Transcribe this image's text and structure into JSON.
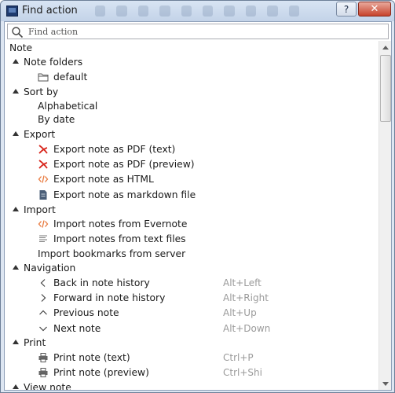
{
  "window": {
    "title": "Find action",
    "help_label": "?",
    "close_label": "✕"
  },
  "search": {
    "placeholder": "Find action"
  },
  "root_label": "Note",
  "groups": {
    "note_folders": {
      "label": "Note folders",
      "items": {
        "default": "default"
      }
    },
    "sort_by": {
      "label": "Sort by",
      "items": {
        "alphabetical": "Alphabetical",
        "by_date": "By date"
      }
    },
    "export": {
      "label": "Export",
      "items": {
        "pdf_text": "Export note as PDF (text)",
        "pdf_preview": "Export note as PDF (preview)",
        "html": "Export note as HTML",
        "markdown": "Export note as markdown file"
      }
    },
    "import": {
      "label": "Import",
      "items": {
        "evernote": "Import notes from Evernote",
        "text_files": "Import notes from text files",
        "bookmarks": "Import bookmarks from server"
      }
    },
    "navigation": {
      "label": "Navigation",
      "items": {
        "back": {
          "label": "Back in note history",
          "shortcut": "Alt+Left"
        },
        "forward": {
          "label": "Forward in note history",
          "shortcut": "Alt+Right"
        },
        "previous": {
          "label": "Previous note",
          "shortcut": "Alt+Up"
        },
        "next": {
          "label": "Next note",
          "shortcut": "Alt+Down"
        }
      }
    },
    "print": {
      "label": "Print",
      "items": {
        "text": {
          "label": "Print note (text)",
          "shortcut": "Ctrl+P"
        },
        "preview": {
          "label": "Print note (preview)",
          "shortcut": "Ctrl+Shi"
        }
      }
    },
    "view_note": {
      "label": "View note"
    }
  },
  "icons": {
    "folder": "folder-icon",
    "pdf": "pdf-icon",
    "html": "code-icon",
    "markdown": "document-icon",
    "text_file": "text-lines-icon",
    "back": "chevron-left-icon",
    "forward": "chevron-right-icon",
    "up": "chevron-up-icon",
    "down": "chevron-down-icon",
    "printer": "printer-icon"
  },
  "colors": {
    "pdf_red": "#d8261c",
    "html_orange": "#e8783c",
    "shortcut_gray": "#9a9a9a",
    "title_gradient_top": "#d8e4f3",
    "close_red": "#c7432c"
  }
}
